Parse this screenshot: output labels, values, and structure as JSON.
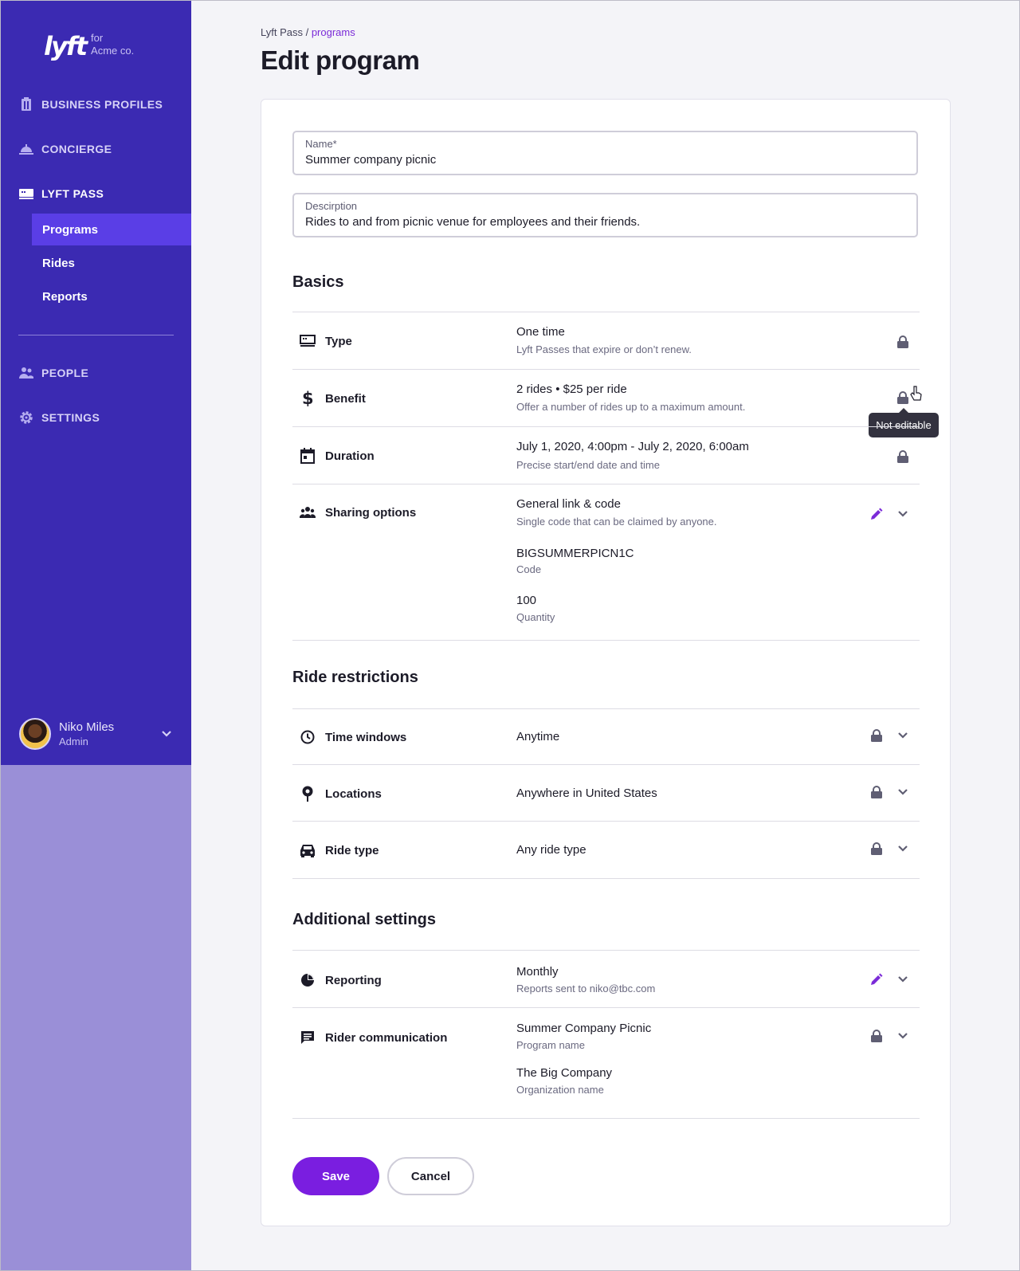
{
  "sidebar": {
    "brand": {
      "logo": "lyft",
      "for": "for",
      "org": "Acme co."
    },
    "nav": {
      "business_profiles": "BUSINESS PROFILES",
      "concierge": "CONCIERGE",
      "lyft_pass": "LYFT PASS",
      "people": "PEOPLE",
      "settings": "SETTINGS"
    },
    "sub": {
      "programs": "Programs",
      "rides": "Rides",
      "reports": "Reports"
    },
    "user": {
      "name": "Niko Miles",
      "role": "Admin"
    }
  },
  "breadcrumb": {
    "root": "Lyft Pass",
    "sep": " / ",
    "current": "programs"
  },
  "page_title": "Edit program",
  "form": {
    "name": {
      "label": "Name*",
      "value": "Summer company picnic"
    },
    "description": {
      "label": "Descirption",
      "value": "Rides to and from picnic venue for employees and their friends."
    }
  },
  "basics": {
    "title": "Basics",
    "type": {
      "label": "Type",
      "value": "One time",
      "sub": "Lyft Passes that expire or don’t renew."
    },
    "benefit": {
      "label": "Benefit",
      "value": "2 rides • $25 per ride",
      "sub": "Offer a number of rides up to a maximum amount.",
      "tooltip": "Not editable"
    },
    "duration": {
      "label": "Duration",
      "value": "July 1, 2020, 4:00pm - July 2, 2020, 6:00am",
      "sub": "Precise start/end date and time"
    },
    "sharing": {
      "label": "Sharing options",
      "value": "General link & code",
      "sub": "Single code that can be claimed by anyone.",
      "code": "BIGSUMMERPICN1C",
      "code_label": "Code",
      "quantity": "100",
      "quantity_label": "Quantity"
    }
  },
  "restrictions": {
    "title": "Ride restrictions",
    "time_windows": {
      "label": "Time windows",
      "value": "Anytime"
    },
    "locations": {
      "label": "Locations",
      "value": "Anywhere in United States"
    },
    "ride_type": {
      "label": "Ride type",
      "value": "Any ride type"
    }
  },
  "additional": {
    "title": "Additional settings",
    "reporting": {
      "label": "Reporting",
      "value": "Monthly",
      "sub": "Reports sent to niko@tbc.com"
    },
    "communication": {
      "label": "Rider communication",
      "program_name": "Summer Company Picnic",
      "program_name_label": "Program name",
      "org_name": "The Big Company",
      "org_name_label": "Organization name"
    }
  },
  "buttons": {
    "save": "Save",
    "cancel": "Cancel"
  },
  "colors": {
    "sidebar": "#3b2ab2",
    "sidebar_lower": "#9a8fd7",
    "selected": "#5a3ee6",
    "accent": "#7a1ee0",
    "edit_icon": "#7b2bd8"
  }
}
